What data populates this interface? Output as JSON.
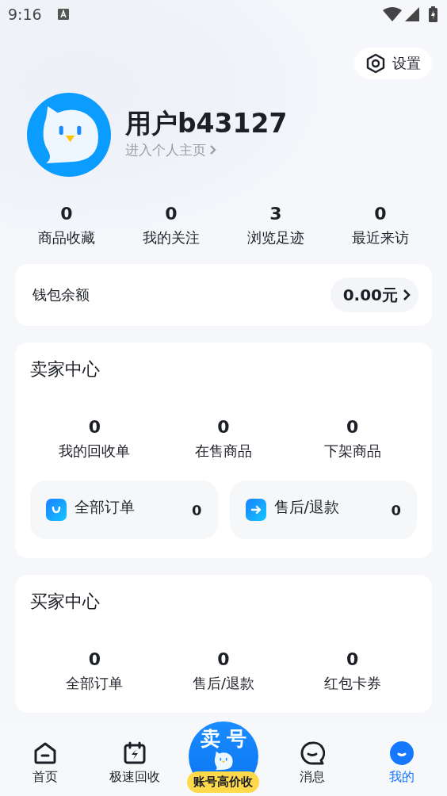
{
  "status_bar": {
    "time": "9:16"
  },
  "settings": {
    "label": "设置"
  },
  "profile": {
    "name": "用户b43127",
    "link": "进入个人主页"
  },
  "stats": [
    {
      "value": "0",
      "label": "商品收藏"
    },
    {
      "value": "0",
      "label": "我的关注"
    },
    {
      "value": "3",
      "label": "浏览足迹"
    },
    {
      "value": "0",
      "label": "最近来访"
    }
  ],
  "wallet": {
    "label": "钱包余额",
    "amount": "0.00元"
  },
  "seller_center": {
    "title": "卖家中心",
    "stats": [
      {
        "value": "0",
        "label": "我的回收单"
      },
      {
        "value": "0",
        "label": "在售商品"
      },
      {
        "value": "0",
        "label": "下架商品"
      }
    ],
    "shortcuts": [
      {
        "kind": "bag",
        "label": "全部订单",
        "count": "0"
      },
      {
        "kind": "arrow",
        "label": "售后/退款",
        "count": "0"
      }
    ]
  },
  "buyer_center": {
    "title": "买家中心",
    "stats": [
      {
        "value": "0",
        "label": "全部订单"
      },
      {
        "value": "0",
        "label": "售后/退款"
      },
      {
        "value": "0",
        "label": "红包卡券"
      }
    ]
  },
  "tab_bar": {
    "items": [
      {
        "kind": "home",
        "label": "首页",
        "selected": false
      },
      {
        "kind": "flash",
        "label": "极速回收",
        "selected": false
      },
      {
        "kind": "sell",
        "title": "卖号",
        "label": "账号高价收",
        "selected": false
      },
      {
        "kind": "message",
        "label": "消息",
        "selected": false
      },
      {
        "kind": "me",
        "label": "我的",
        "selected": true
      }
    ]
  }
}
